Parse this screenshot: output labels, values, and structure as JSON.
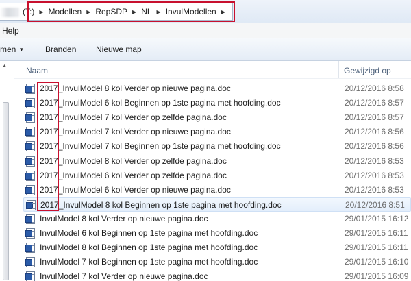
{
  "address": {
    "segments": [
      "(T:)",
      "Modellen",
      "RepSDP",
      "NL",
      "InvulModellen"
    ]
  },
  "menu": {
    "help": "Help"
  },
  "toolbar": {
    "organize_fragment": "men",
    "branden": "Branden",
    "nieuwe_map": "Nieuwe map"
  },
  "columns": {
    "name": "Naam",
    "modified": "Gewijzigd op"
  },
  "files": [
    {
      "name": "2017_InvulModel 8 kol Verder op nieuwe pagina.doc",
      "date": "20/12/2016 8:58"
    },
    {
      "name": "2017_InvulModel 6 kol Beginnen op 1ste pagina met hoofding.doc",
      "date": "20/12/2016 8:57"
    },
    {
      "name": "2017_InvulModel 7 kol Verder op zelfde pagina.doc",
      "date": "20/12/2016 8:57"
    },
    {
      "name": "2017_InvulModel 7 kol Verder op nieuwe pagina.doc",
      "date": "20/12/2016 8:56"
    },
    {
      "name": "2017_InvulModel 7 kol Beginnen op 1ste pagina met hoofding.doc",
      "date": "20/12/2016 8:56"
    },
    {
      "name": "2017_InvulModel 8 kol Verder op zelfde pagina.doc",
      "date": "20/12/2016 8:53"
    },
    {
      "name": "2017_InvulModel 6 kol Verder op zelfde pagina.doc",
      "date": "20/12/2016 8:53"
    },
    {
      "name": "2017_InvulModel 6 kol Verder op nieuwe pagina.doc",
      "date": "20/12/2016 8:53"
    },
    {
      "name": "2017_InvulModel 8 kol Beginnen op 1ste pagina met hoofding.doc",
      "date": "20/12/2016 8:51"
    },
    {
      "name": "InvulModel 8 kol Verder op nieuwe pagina.doc",
      "date": "29/01/2015 16:12"
    },
    {
      "name": "InvulModel 6 kol Beginnen op 1ste pagina met hoofding.doc",
      "date": "29/01/2015 16:11"
    },
    {
      "name": "InvulModel 8 kol Beginnen op 1ste pagina met hoofding.doc",
      "date": "29/01/2015 16:11"
    },
    {
      "name": "InvulModel 7 kol Beginnen op 1ste pagina met hoofding.doc",
      "date": "29/01/2015 16:10"
    },
    {
      "name": "InvulModel 7 kol Verder op nieuwe pagina.doc",
      "date": "29/01/2015 16:09"
    }
  ],
  "selected_index": 8,
  "colors": {
    "highlight": "#c8102e",
    "selection": "#e3eefb",
    "header_text": "#4c607a"
  }
}
